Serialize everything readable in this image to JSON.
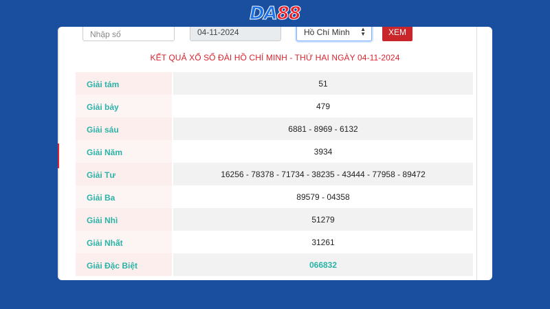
{
  "brand": {
    "logo_part1": "DA",
    "logo_part2": "88"
  },
  "form": {
    "number_placeholder": "Nhập số",
    "date_value": "04-11-2024",
    "province_selected": "Hồ Chí Minh",
    "submit_label": "XEM"
  },
  "result": {
    "title": "KẾT QUẢ XỔ SỐ ĐÀI HỒ CHÍ MINH - THỨ HAI NGÀY 04-11-2024",
    "rows": [
      {
        "label": "Giải tám",
        "value": "51"
      },
      {
        "label": "Giải bảy",
        "value": "479"
      },
      {
        "label": "Giải sáu",
        "value": "6881 - 8969 - 6132"
      },
      {
        "label": "Giải Năm",
        "value": "3934"
      },
      {
        "label": "Giải Tư",
        "value": "16256 - 78378 - 71734 - 38235 - 43444 - 77958 - 89472"
      },
      {
        "label": "Giải Ba",
        "value": "89579 - 04358"
      },
      {
        "label": "Giải Nhì",
        "value": "51279"
      },
      {
        "label": "Giải Nhất",
        "value": "31261"
      },
      {
        "label": "Giải Đặc Biệt",
        "value": "066832"
      }
    ]
  },
  "colors": {
    "background": "#1a4fa0",
    "accent_red": "#d9232d",
    "label_teal": "#2bb3a7"
  }
}
